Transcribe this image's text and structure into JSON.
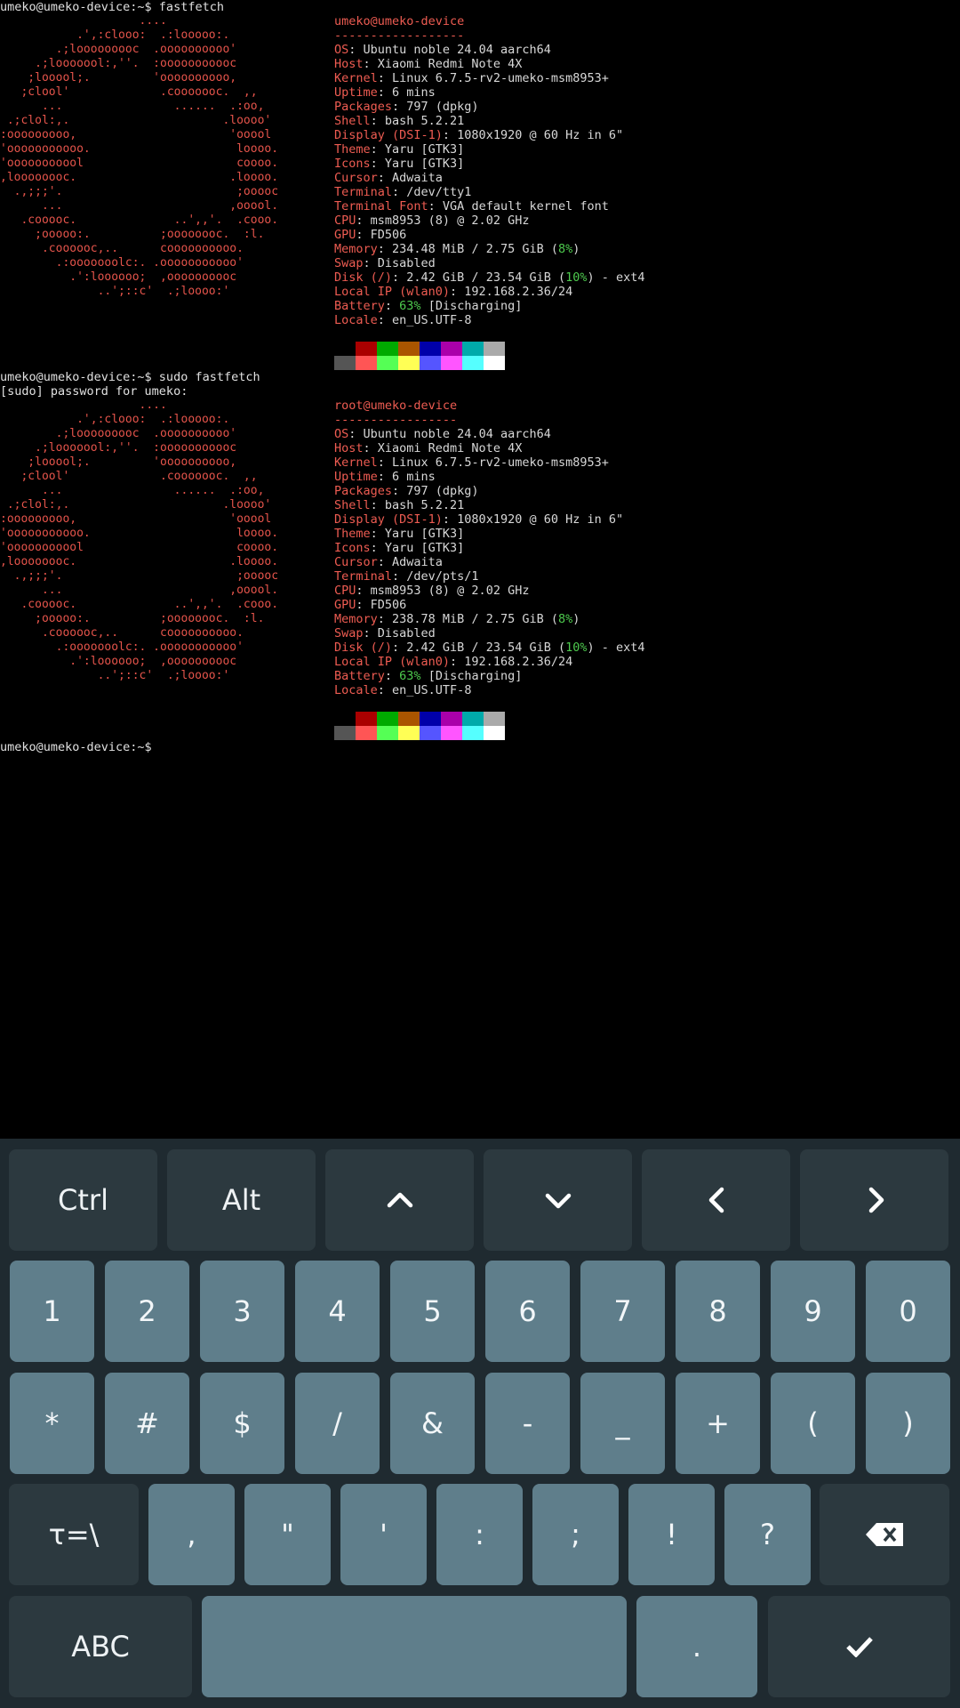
{
  "terminal": {
    "prompt1": "umeko@umeko-device:~$ fastfetch",
    "prompt2": "umeko@umeko-device:~$ sudo fastfetch",
    "sudo_line": "[sudo] password for umeko:",
    "prompt3": "umeko@umeko-device:~$",
    "logo_lines": [
      "                    ....",
      "           .',:clooo:  .:looooo:.",
      "        .;looooooooc  .oooooooooo'",
      "     .;looooool:,''.  :ooooooooooc",
      "    ;looool;.         'oooooooooo,",
      "   ;clool'             .cooooooc.  ,,",
      "      ...                ......  .:oo,",
      " .;clol:,.                      .loooo'",
      ":ooooooooo,                      'ooool",
      "'ooooooooooo.                     loooo.",
      "'ooooooooool                      coooo.",
      ",loooooooc.                      .loooo.",
      "  .,;;;'.                         ;ooooc",
      "      ...                        ,ooool.",
      "   .cooooc.              ..',,'.  .cooo.",
      "     ;ooooo:.          ;oooooooc.  :l.",
      "      .coooooc,..      coooooooooo.",
      "        .:ooooooolc:. .ooooooooooo'",
      "          .':loooooo;  ,oooooooooc",
      "              ..';::c'  .;loooo:'"
    ],
    "block1": {
      "title": "umeko@umeko-device",
      "separator": "------------------",
      "lines": [
        {
          "k": "OS",
          "v": ": Ubuntu noble 24.04 aarch64"
        },
        {
          "k": "Host",
          "v": ": Xiaomi Redmi Note 4X"
        },
        {
          "k": "Kernel",
          "v": ": Linux 6.7.5-rv2-umeko-msm8953+"
        },
        {
          "k": "Uptime",
          "v": ": 6 mins"
        },
        {
          "k": "Packages",
          "v": ": 797 (dpkg)"
        },
        {
          "k": "Shell",
          "v": ": bash 5.2.21"
        },
        {
          "k": "Display (DSI-1)",
          "v": ": 1080x1920 @ 60 Hz in 6\""
        },
        {
          "k": "Theme",
          "v": ": Yaru [GTK3]"
        },
        {
          "k": "Icons",
          "v": ": Yaru [GTK3]"
        },
        {
          "k": "Cursor",
          "v": ": Adwaita"
        },
        {
          "k": "Terminal",
          "v": ": /dev/tty1"
        },
        {
          "k": "Terminal Font",
          "v": ": VGA default kernel font"
        },
        {
          "k": "CPU",
          "v": ": msm8953 (8) @ 2.02 GHz"
        },
        {
          "k": "GPU",
          "v": ": FD506"
        },
        {
          "k": "Memory",
          "v": ": 234.48 MiB / 2.75 GiB (",
          "p": "8%",
          "t": ")"
        },
        {
          "k": "Swap",
          "v": ": Disabled"
        },
        {
          "k": "Disk (/)",
          "v": ": 2.42 GiB / 23.54 GiB (",
          "p": "10%",
          "t": ") - ext4"
        },
        {
          "k": "Local IP (wlan0)",
          "v": ": 192.168.2.36/24"
        },
        {
          "k": "Battery",
          "v": ": ",
          "p": "63%",
          "t": " [Discharging]"
        },
        {
          "k": "Locale",
          "v": ": en_US.UTF-8"
        }
      ]
    },
    "block2": {
      "title": "root@umeko-device",
      "separator": "-----------------",
      "lines": [
        {
          "k": "OS",
          "v": ": Ubuntu noble 24.04 aarch64"
        },
        {
          "k": "Host",
          "v": ": Xiaomi Redmi Note 4X"
        },
        {
          "k": "Kernel",
          "v": ": Linux 6.7.5-rv2-umeko-msm8953+"
        },
        {
          "k": "Uptime",
          "v": ": 6 mins"
        },
        {
          "k": "Packages",
          "v": ": 797 (dpkg)"
        },
        {
          "k": "Shell",
          "v": ": bash 5.2.21"
        },
        {
          "k": "Display (DSI-1)",
          "v": ": 1080x1920 @ 60 Hz in 6\""
        },
        {
          "k": "Theme",
          "v": ": Yaru [GTK3]"
        },
        {
          "k": "Icons",
          "v": ": Yaru [GTK3]"
        },
        {
          "k": "Cursor",
          "v": ": Adwaita"
        },
        {
          "k": "Terminal",
          "v": ": /dev/pts/1"
        },
        {
          "k": "CPU",
          "v": ": msm8953 (8) @ 2.02 GHz"
        },
        {
          "k": "GPU",
          "v": ": FD506"
        },
        {
          "k": "Memory",
          "v": ": 238.78 MiB / 2.75 GiB (",
          "p": "8%",
          "t": ")"
        },
        {
          "k": "Swap",
          "v": ": Disabled"
        },
        {
          "k": "Disk (/)",
          "v": ": 2.42 GiB / 23.54 GiB (",
          "p": "10%",
          "t": ") - ext4"
        },
        {
          "k": "Local IP (wlan0)",
          "v": ": 192.168.2.36/24"
        },
        {
          "k": "Battery",
          "v": ": ",
          "p": "63%",
          "t": " [Discharging]"
        },
        {
          "k": "Locale",
          "v": ": en_US.UTF-8"
        }
      ]
    },
    "palette_dark": [
      "#000000",
      "#aa0000",
      "#00aa00",
      "#aa5500",
      "#0000aa",
      "#aa00aa",
      "#00aaaa",
      "#aaaaaa"
    ],
    "palette_bright": [
      "#555555",
      "#ff5555",
      "#55ff55",
      "#ffff55",
      "#5555ff",
      "#ff55ff",
      "#55ffff",
      "#ffffff"
    ]
  },
  "keyboard": {
    "row1": [
      {
        "label": "Ctrl",
        "name": "ctrl-key"
      },
      {
        "label": "Alt",
        "name": "alt-key"
      },
      {
        "label": "",
        "name": "arrow-up-key",
        "icon": "chevron-up-icon"
      },
      {
        "label": "",
        "name": "arrow-down-key",
        "icon": "chevron-down-icon"
      },
      {
        "label": "",
        "name": "arrow-left-key",
        "icon": "chevron-left-icon"
      },
      {
        "label": "",
        "name": "arrow-right-key",
        "icon": "chevron-right-icon"
      }
    ],
    "row2": [
      "1",
      "2",
      "3",
      "4",
      "5",
      "6",
      "7",
      "8",
      "9",
      "0"
    ],
    "row3": [
      "*",
      "#",
      "$",
      "/",
      "&",
      "-",
      "_",
      "+",
      "(",
      ")"
    ],
    "row4": [
      ",",
      "\"",
      "'",
      ":",
      ";",
      "!",
      "?"
    ],
    "symbols_toggle": "τ=\\",
    "abc_label": "ABC",
    "period_label": "."
  }
}
